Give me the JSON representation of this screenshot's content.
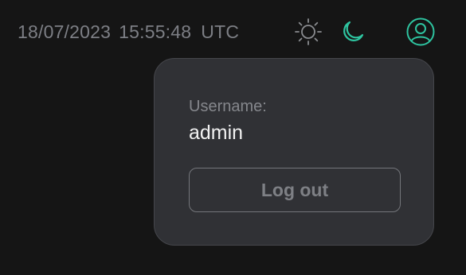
{
  "header": {
    "date": "18/07/2023",
    "time": "15:55:48",
    "timezone": "UTC"
  },
  "theme_toggle": {
    "light_icon": "sun-icon",
    "dark_icon": "moon-icon",
    "active": "dark",
    "accent_color": "#2ec4a0"
  },
  "user_menu": {
    "icon": "user-circle-icon",
    "username_label": "Username:",
    "username": "admin",
    "logout_label": "Log out"
  },
  "colors": {
    "background": "#151515",
    "panel": "#303135",
    "muted_text": "#7d7f85",
    "accent": "#2ec4a0"
  }
}
